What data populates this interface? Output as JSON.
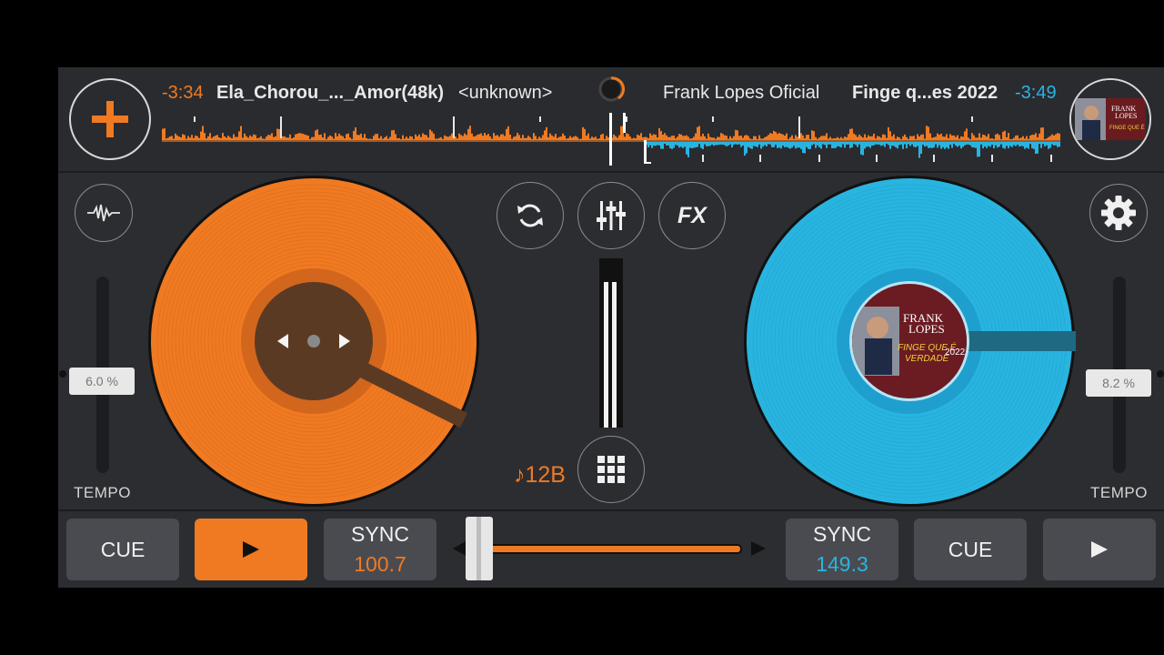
{
  "deckA": {
    "time": "-3:34",
    "title": "Ela_Chorou_..._Amor(48k)",
    "artist": "<unknown>",
    "color": "#ef7a22",
    "tempo_pct": "6.0 %",
    "tempo_label": "TEMPO",
    "cue_label": "CUE",
    "sync_label": "SYNC",
    "bpm": "100.7"
  },
  "deckB": {
    "time": "-3:49",
    "title": "Finge q...es 2022",
    "artist": "Frank Lopes Oficial",
    "color": "#29b4e0",
    "tempo_pct": "8.2 %",
    "tempo_label": "TEMPO",
    "cue_label": "CUE",
    "sync_label": "SYNC",
    "bpm": "149.3",
    "artwork": {
      "line1": "FRANK",
      "line2": "LOPES",
      "tagline1": "FINGE QUE É",
      "tagline2": "VERDADE",
      "year": "2022"
    }
  },
  "center": {
    "fx_label": "FX",
    "key": "♪12B"
  },
  "icons": [
    "add-icon",
    "waveform-icon",
    "sync-loop-icon",
    "mixer-icon",
    "fx-icon",
    "settings-icon",
    "grid-icon",
    "play-icon",
    "arrow-left-icon",
    "arrow-right-icon"
  ],
  "colors": {
    "background": "#2c2d31",
    "pad": "#4a4b50",
    "accentA": "#ef7a22",
    "accentB": "#29b4e0"
  }
}
